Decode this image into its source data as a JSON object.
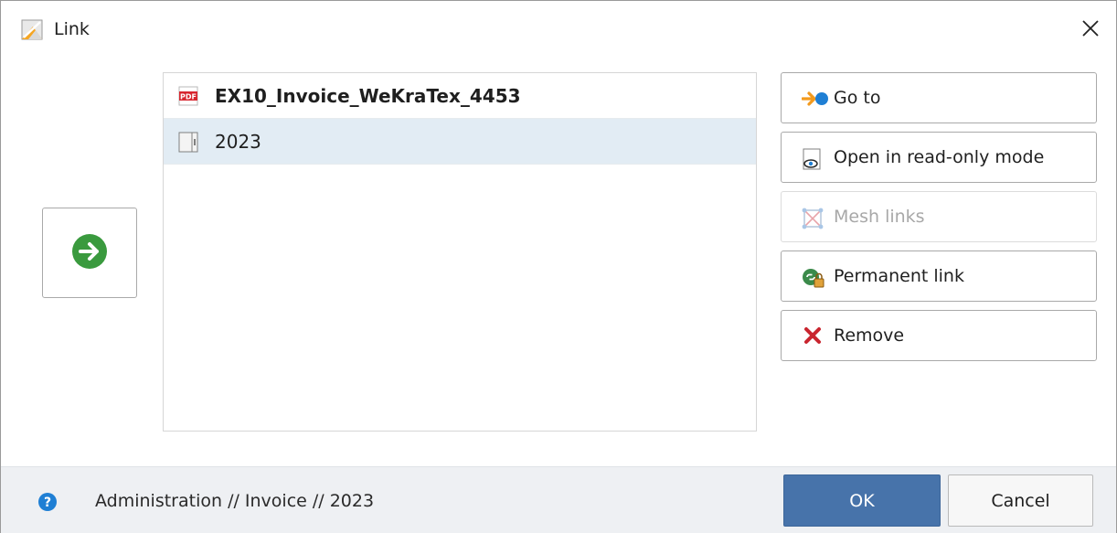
{
  "window": {
    "title": "Link",
    "title_icon": "link-document-icon",
    "close_icon": "close-icon"
  },
  "navigate_button": {
    "icon": "arrow-right-circle-icon",
    "color": "#3a9a3e"
  },
  "list": {
    "items": [
      {
        "label": "EX10_Invoice_WeKraTex_4453",
        "icon": "pdf-icon",
        "bold": true,
        "selected": false
      },
      {
        "label": "2023",
        "icon": "register-folder-icon",
        "bold": false,
        "selected": true
      }
    ]
  },
  "actions": {
    "go_to": {
      "label": "Go to",
      "icon": "go-to-icon",
      "enabled": true
    },
    "open_readonly": {
      "label": "Open in read-only mode",
      "icon": "read-only-icon",
      "enabled": true
    },
    "mesh_links": {
      "label": "Mesh links",
      "icon": "mesh-links-icon",
      "enabled": false
    },
    "permanent_link": {
      "label": "Permanent link",
      "icon": "permanent-link-icon",
      "enabled": true
    },
    "remove": {
      "label": "Remove",
      "icon": "remove-icon",
      "enabled": true
    }
  },
  "footer": {
    "help_icon": "help-icon",
    "path": "Administration // Invoice // 2023",
    "ok_label": "OK",
    "cancel_label": "Cancel"
  },
  "colors": {
    "accent": "#4773aa",
    "selection": "#e2ecf4",
    "remove_red": "#c9252f",
    "go_orange": "#f39a1d",
    "help_blue": "#1f7fd4"
  }
}
